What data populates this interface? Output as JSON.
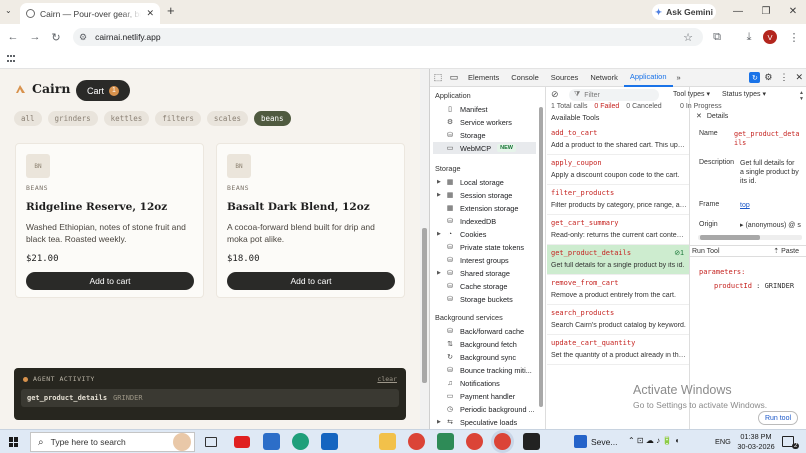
{
  "browser": {
    "tab_title": "Cairn — Pour-over gear, built for agents",
    "gemini_label": "Ask Gemini",
    "url": "cairnai.netlify.app",
    "profile_initial": "V"
  },
  "store": {
    "brand": "Cairn",
    "cart_label": "Cart",
    "cart_count": "1",
    "filters": [
      "all",
      "grinders",
      "kettles",
      "filters",
      "scales",
      "beans"
    ],
    "active_filter": "beans",
    "products": [
      {
        "initials": "BN",
        "category": "BEANS",
        "name": "Ridgeline Reserve, 12oz",
        "description": "Washed Ethiopian, notes of stone fruit and black tea. Roasted weekly.",
        "price": "$21.00",
        "button": "Add to cart"
      },
      {
        "initials": "BN",
        "category": "BEANS",
        "name": "Basalt Dark Blend, 12oz",
        "description": "A cocoa-forward blend built for drip and moka pot alike.",
        "price": "$18.00",
        "button": "Add to cart"
      }
    ],
    "agent_activity": {
      "title": "AGENT ACTIVITY",
      "clear_label": "clear",
      "entry_tool": "get_product_details",
      "entry_arg": "GRINDER"
    }
  },
  "devtools": {
    "tabs": [
      "Elements",
      "Console",
      "Sources",
      "Network",
      "Application"
    ],
    "active_tab": "Application",
    "sidebar": {
      "application_header": "Application",
      "application_items": [
        "Manifest",
        "Service workers",
        "Storage",
        "WebMCP"
      ],
      "new_badge": "NEW",
      "storage_header": "Storage",
      "storage_items": [
        "Local storage",
        "Session storage",
        "Extension storage",
        "IndexedDB",
        "Cookies",
        "Private state tokens",
        "Interest groups",
        "Shared storage",
        "Cache storage",
        "Storage buckets"
      ],
      "background_header": "Background services",
      "background_items": [
        "Back/forward cache",
        "Background fetch",
        "Background sync",
        "Bounce tracking miti...",
        "Notifications",
        "Payment handler",
        "Periodic background ...",
        "Speculative loads"
      ]
    },
    "filter_placeholder": "Filter",
    "tool_types_label": "Tool types",
    "status_types_label": "Status types",
    "stats": {
      "total": "1 Total calls",
      "failed": "0 Failed",
      "canceled": "0 Canceled",
      "in_progress": "0 In Progress"
    },
    "available_tools_label": "Available Tools",
    "tools": [
      {
        "name": "add_to_cart",
        "desc": "Add a product to the shared cart. This updates the cart."
      },
      {
        "name": "apply_coupon",
        "desc": "Apply a discount coupon code to the cart."
      },
      {
        "name": "filter_products",
        "desc": "Filter products by category, price range, and more."
      },
      {
        "name": "get_cart_summary",
        "desc": "Read-only: returns the current cart contents."
      },
      {
        "name": "get_product_details",
        "desc": "Get full details for a single product by its id.",
        "count": "1"
      },
      {
        "name": "remove_from_cart",
        "desc": "Remove a product entirely from the cart."
      },
      {
        "name": "search_products",
        "desc": "Search Cairn's product catalog by keyword."
      },
      {
        "name": "update_cart_quantity",
        "desc": "Set the quantity of a product already in the cart."
      }
    ],
    "details": {
      "header": "Details",
      "name_label": "Name",
      "name_value": "get_product_details",
      "description_label": "Description",
      "description_value": "Get full details for a single product by its id.",
      "frame_label": "Frame",
      "frame_value": "top",
      "origin_label": "Origin",
      "origin_value": "(anonymous) @ s",
      "run_tool_label": "Run Tool",
      "paste_label": "Paste",
      "params_key": "parameters:",
      "param_name": "productId",
      "param_value": "GRINDER",
      "run_button": "Run tool"
    }
  },
  "watermark": {
    "title": "Activate Windows",
    "subtitle": "Go to Settings to activate Windows."
  },
  "taskbar": {
    "search_placeholder": "Type here to search",
    "window_label": "Seve...",
    "lang": "ENG",
    "time": "01:38 PM",
    "date": "30-03-2026",
    "notif_count": "2"
  }
}
